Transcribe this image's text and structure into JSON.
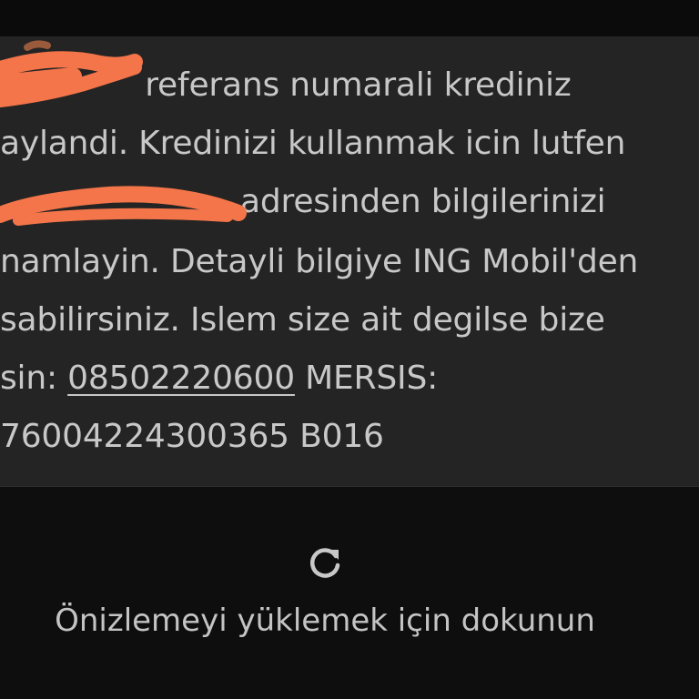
{
  "message": {
    "line1_text": " referans numarali krediniz",
    "line2_text": "aylandi. Kredinizi kullanmak icin lutfen",
    "line3_text": "adresinden bilgilerinizi",
    "line4_text": "namlayin. Detayli bilgiye ING Mobil'den",
    "line5_text": "sabilirsiniz. Islem size ait degilse bize",
    "line6_prefix": "sin: ",
    "phone_number": "08502220600",
    "line6_suffix": " MERSIS:",
    "line7_text": "76004224300365 B016"
  },
  "preview": {
    "icon": "refresh-icon",
    "label": "Önizlemeyi yüklemek için dokunun"
  },
  "colors": {
    "bubble_background": "#242424",
    "screen_background": "#0c0c0c",
    "text": "#c8c8c8",
    "redaction_marker": "#f4754a"
  }
}
